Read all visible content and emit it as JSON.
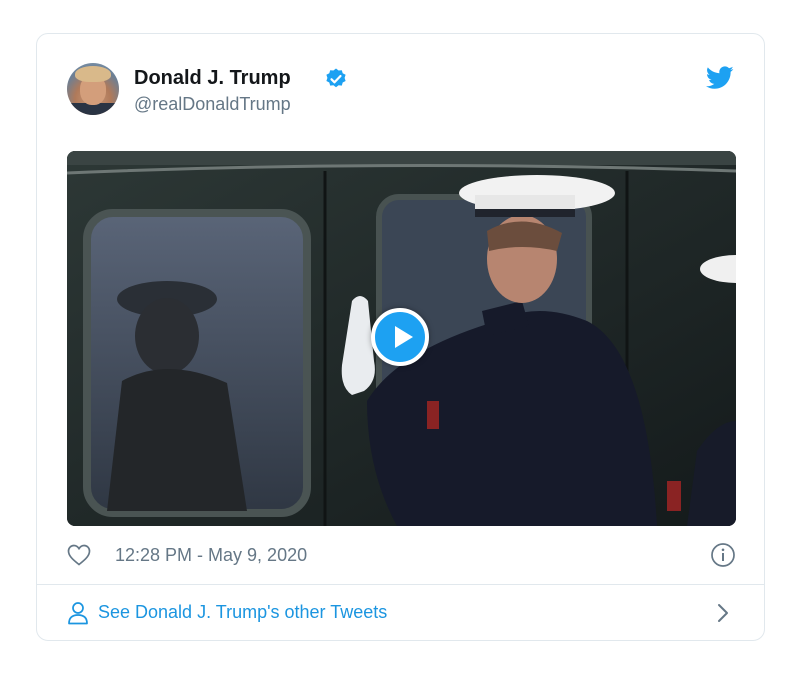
{
  "tweet": {
    "author_name": "Donald J. Trump",
    "handle": "@realDonaldTrump",
    "timestamp": "12:28 PM - May 9, 2020",
    "see_more": "See Donald J. Trump's other Tweets"
  },
  "icons": {
    "verified": "verified-badge-icon",
    "bird": "twitter-bird-icon",
    "heart": "heart-icon",
    "info": "info-icon",
    "person": "person-icon",
    "chevron": "chevron-right-icon",
    "play": "play-icon"
  },
  "colors": {
    "accent": "#1da1f2",
    "link": "#1b95e0",
    "secondary_text": "#657786",
    "border": "#e1e8ed"
  }
}
